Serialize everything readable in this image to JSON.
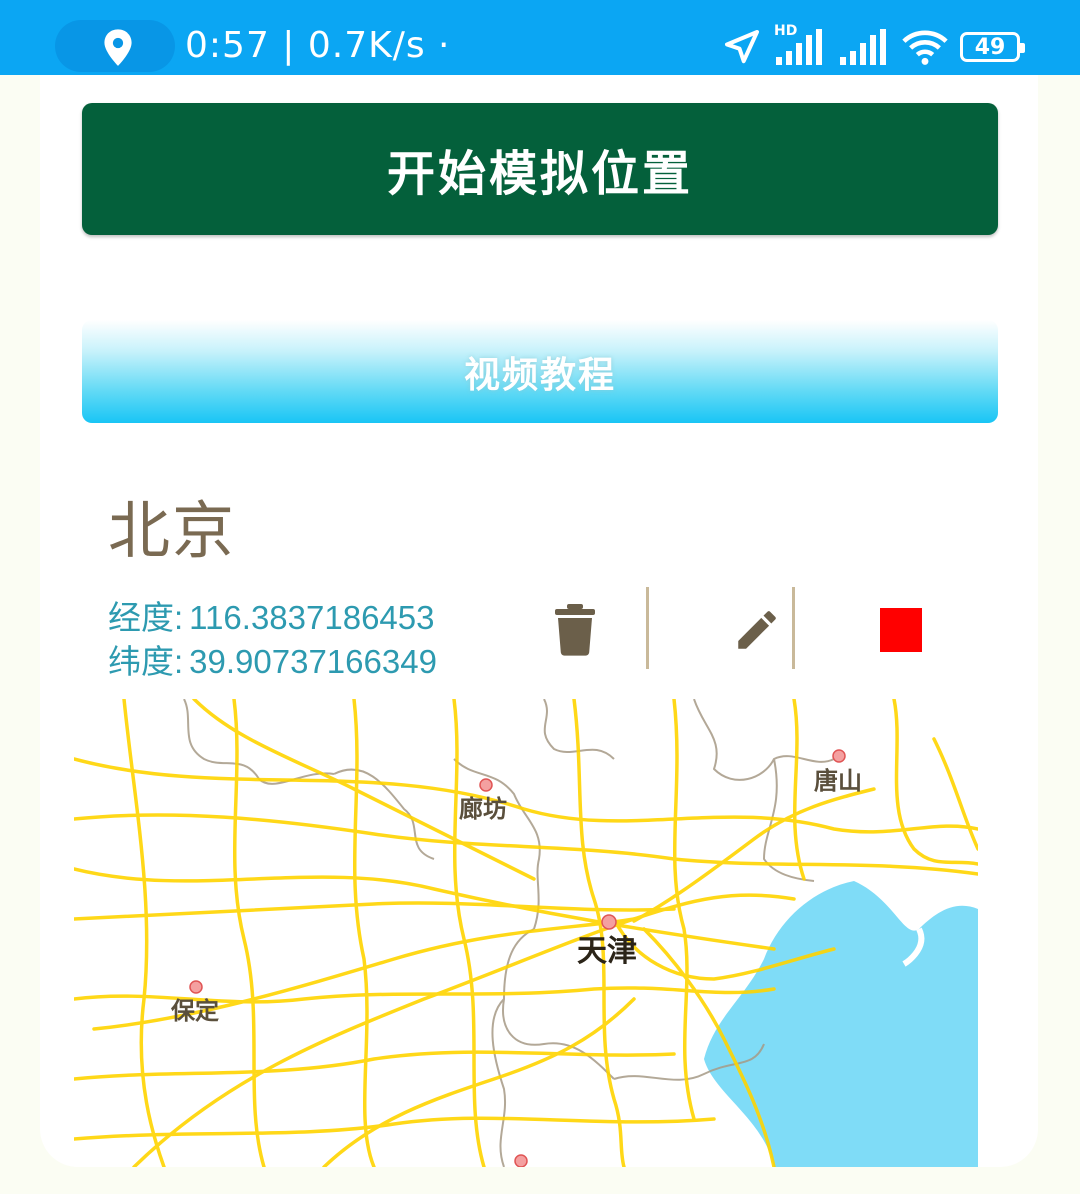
{
  "status_bar": {
    "time_speed": "0:57 | 0.7K/s ·",
    "network": "HD",
    "battery": "49",
    "accent_color": "#0ba6f3"
  },
  "buttons": {
    "start_label": "开始模拟位置",
    "video_label": "视频教程",
    "start_color": "#04603b"
  },
  "location": {
    "name": "北京",
    "longitude_label": "经度:",
    "longitude_value": "116.3837186453",
    "latitude_label": "纬度:",
    "latitude_value": "39.90737166349"
  },
  "actions": {
    "delete_icon": "trash-icon",
    "edit_icon": "pencil-icon",
    "stop_icon": "red-square-icon",
    "stop_color": "#ff0000"
  },
  "map": {
    "labels": [
      "廊坊",
      "唐山",
      "天津",
      "保定"
    ],
    "road_color": "#ffd400",
    "water_color": "#7fdcf7"
  }
}
